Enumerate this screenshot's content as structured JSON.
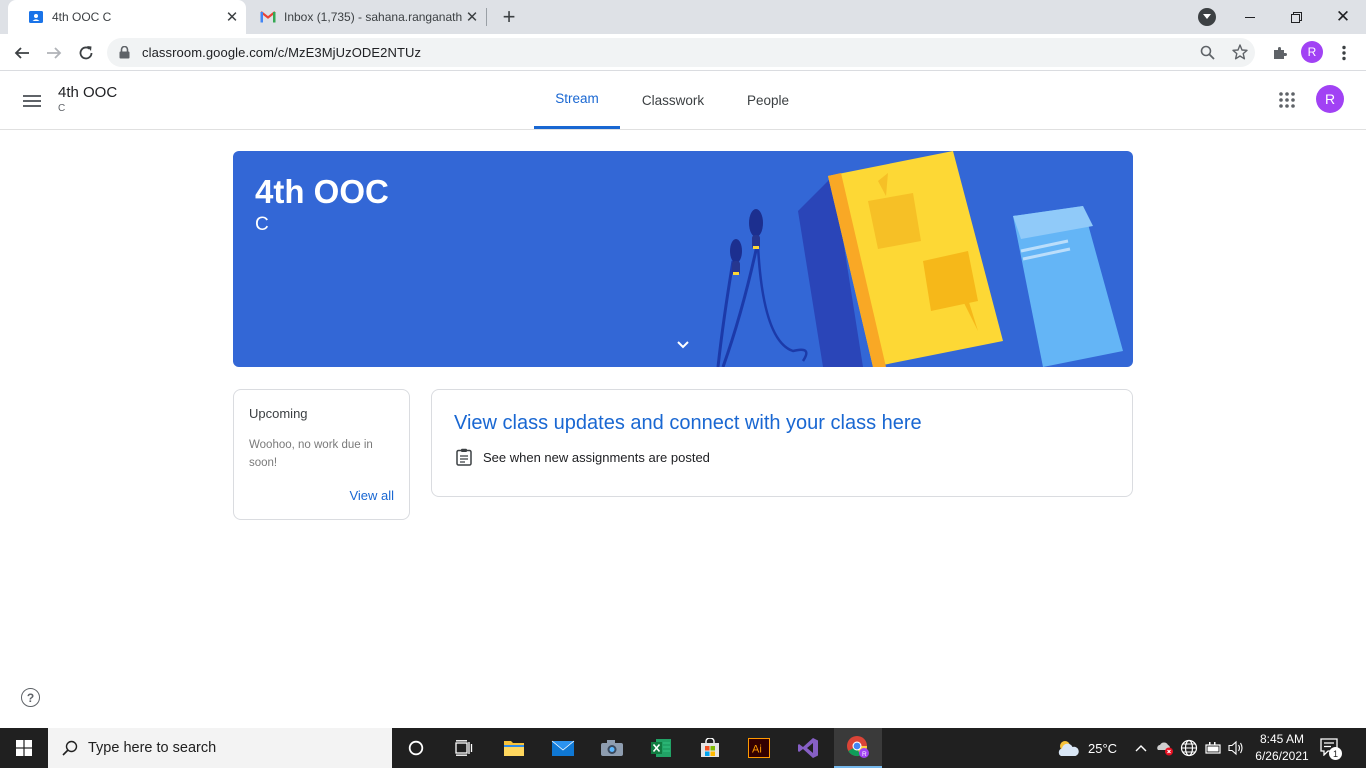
{
  "browser": {
    "tabs": [
      {
        "title": "4th OOC C",
        "active": true
      },
      {
        "title": "Inbox (1,735) - sahana.ranganath",
        "active": false
      }
    ],
    "new_tab_label": "+",
    "url": "classroom.google.com/c/MzE3MjUzODE2NTUz",
    "profile_initial": "R"
  },
  "classroom": {
    "class_name": "4th OOC",
    "section": "C",
    "nav_tabs": [
      {
        "label": "Stream",
        "selected": true
      },
      {
        "label": "Classwork",
        "selected": false
      },
      {
        "label": "People",
        "selected": false
      }
    ],
    "profile_initial": "R",
    "banner": {
      "title": "4th OOC",
      "section": "C",
      "color": "#3367d6"
    },
    "upcoming": {
      "heading": "Upcoming",
      "message": "Woohoo, no work due in soon!",
      "view_all": "View all"
    },
    "stream_card": {
      "headline": "View class updates and connect with your class here",
      "line": "See when new assignments are posted"
    },
    "accent_color": "#1967d2"
  },
  "taskbar": {
    "search_placeholder": "Type here to search",
    "weather": "25°C",
    "time": "8:45 AM",
    "date": "6/26/2021",
    "notification_count": "1",
    "app_icons": [
      "cortana-icon",
      "task-view-icon",
      "file-explorer-icon",
      "mail-icon",
      "camera-icon",
      "excel-icon",
      "store-icon",
      "illustrator-icon",
      "visual-studio-icon",
      "chrome-icon"
    ]
  }
}
